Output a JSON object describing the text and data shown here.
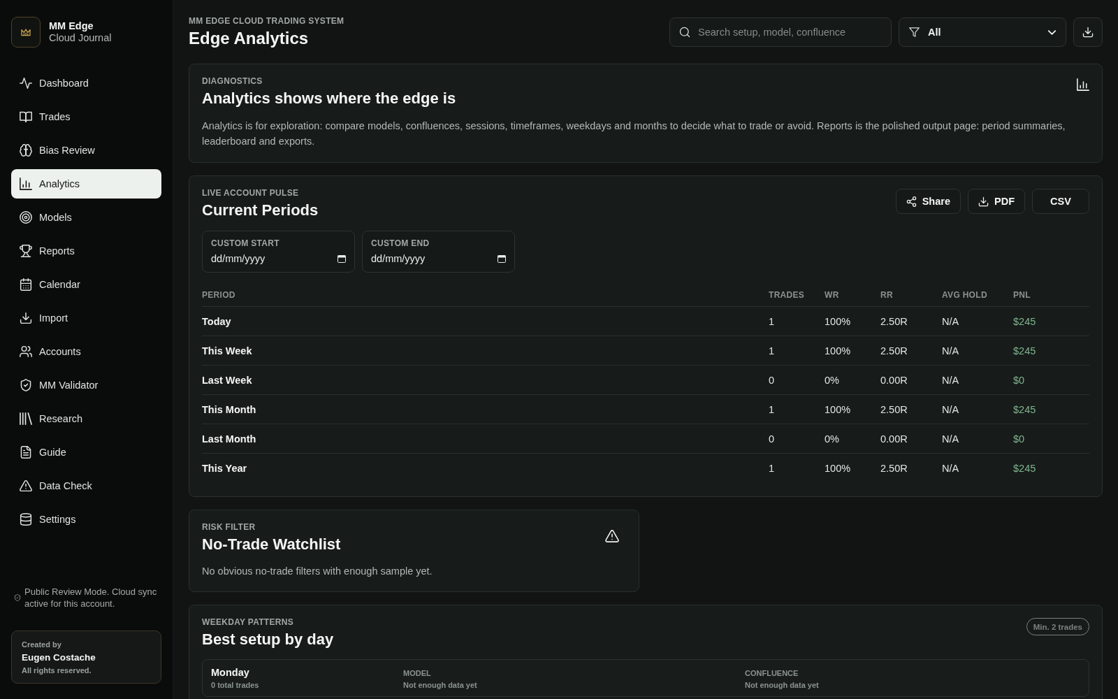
{
  "sidebar": {
    "brand": {
      "title": "MM Edge",
      "subtitle": "Cloud Journal"
    },
    "items": [
      {
        "label": "Dashboard",
        "selected": false
      },
      {
        "label": "Trades",
        "selected": false
      },
      {
        "label": "Bias Review",
        "selected": false
      },
      {
        "label": "Analytics",
        "selected": true
      },
      {
        "label": "Models",
        "selected": false
      },
      {
        "label": "Reports",
        "selected": false
      },
      {
        "label": "Calendar",
        "selected": false
      },
      {
        "label": "Import",
        "selected": false
      },
      {
        "label": "Accounts",
        "selected": false
      },
      {
        "label": "MM Validator",
        "selected": false
      },
      {
        "label": "Research",
        "selected": false
      },
      {
        "label": "Guide",
        "selected": false
      },
      {
        "label": "Data Check",
        "selected": false
      },
      {
        "label": "Settings",
        "selected": false
      }
    ],
    "note": "Public Review Mode. Cloud sync active for this account.",
    "credit": {
      "caption": "Created by",
      "name": "Eugen Costache",
      "rights": "All rights reserved."
    }
  },
  "header": {
    "eyebrow": "MM EDGE CLOUD TRADING SYSTEM",
    "title": "Edge Analytics",
    "search": {
      "placeholder": "Search setup, model, confluence"
    },
    "filter": {
      "value": "All"
    }
  },
  "diagnostics": {
    "eyebrow": "DIAGNOSTICS",
    "title": "Analytics shows where the edge is",
    "text": "Analytics is for exploration: compare models, confluences, sessions, timeframes, weekdays and months to decide what to trade or avoid. Reports is the polished output page: period summaries, leaderboard and exports."
  },
  "periods": {
    "eyebrow": "LIVE ACCOUNT PULSE",
    "title": "Current Periods",
    "actions": [
      {
        "label": "Share",
        "kind": "share"
      },
      {
        "label": "PDF",
        "kind": "download"
      },
      {
        "label": "CSV",
        "kind": "plain"
      }
    ],
    "date_fields": [
      {
        "label": "CUSTOM START",
        "placeholder": "dd/mm/yyyy"
      },
      {
        "label": "CUSTOM END",
        "placeholder": "dd/mm/yyyy"
      }
    ],
    "table": {
      "columns": [
        "PERIOD",
        "TRADES",
        "WR",
        "RR",
        "AVG HOLD",
        "PNL"
      ],
      "rows": [
        [
          "Today",
          "1",
          "100%",
          "2.50R",
          "N/A",
          "$245"
        ],
        [
          "This Week",
          "1",
          "100%",
          "2.50R",
          "N/A",
          "$245"
        ],
        [
          "Last Week",
          "0",
          "0%",
          "0.00R",
          "N/A",
          "$0"
        ],
        [
          "This Month",
          "1",
          "100%",
          "2.50R",
          "N/A",
          "$245"
        ],
        [
          "Last Month",
          "0",
          "0%",
          "0.00R",
          "N/A",
          "$0"
        ],
        [
          "This Year",
          "1",
          "100%",
          "2.50R",
          "N/A",
          "$245"
        ]
      ]
    }
  },
  "watchlist": {
    "eyebrow": "RISK FILTER",
    "title": "No-Trade Watchlist",
    "text": "No obvious no-trade filters with enough sample yet."
  },
  "weekday": {
    "eyebrow": "WEEKDAY PATTERNS",
    "title": "Best setup by day",
    "badge": "Min. 2 trades",
    "days": [
      {
        "day": "Monday",
        "count": "0 total trades",
        "model_label": "MODEL",
        "model": "Not enough data yet",
        "confluence_label": "CONFLUENCE",
        "confluence": "Not enough data yet"
      }
    ]
  }
}
